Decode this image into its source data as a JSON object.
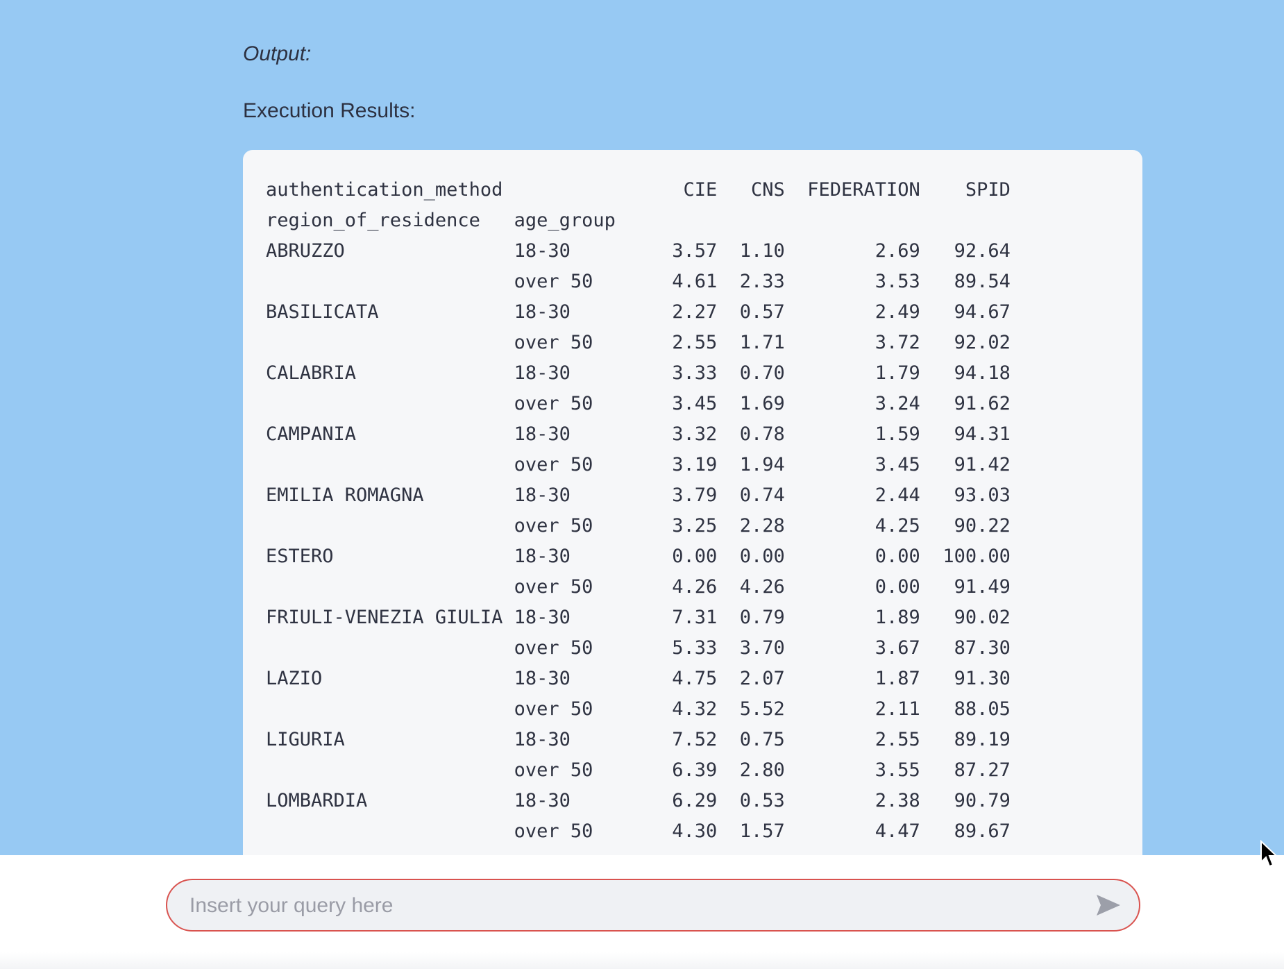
{
  "output_label": "Output:",
  "results_label": "Execution Results:",
  "table": {
    "header_lines": [
      "authentication_method                CIE   CNS  FEDERATION    SPID",
      "region_of_residence   age_group"
    ],
    "rows": [
      "ABRUZZO               18-30         3.57  1.10        2.69   92.64",
      "                      over 50       4.61  2.33        3.53   89.54",
      "BASILICATA            18-30         2.27  0.57        2.49   94.67",
      "                      over 50       2.55  1.71        3.72   92.02",
      "CALABRIA              18-30         3.33  0.70        1.79   94.18",
      "                      over 50       3.45  1.69        3.24   91.62",
      "CAMPANIA              18-30         3.32  0.78        1.59   94.31",
      "                      over 50       3.19  1.94        3.45   91.42",
      "EMILIA ROMAGNA        18-30         3.79  0.74        2.44   93.03",
      "                      over 50       3.25  2.28        4.25   90.22",
      "ESTERO                18-30         0.00  0.00        0.00  100.00",
      "                      over 50       4.26  4.26        0.00   91.49",
      "FRIULI-VENEZIA GIULIA 18-30         7.31  0.79        1.89   90.02",
      "                      over 50       5.33  3.70        3.67   87.30",
      "LAZIO                 18-30         4.75  2.07        1.87   91.30",
      "                      over 50       4.32  5.52        2.11   88.05",
      "LIGURIA               18-30         7.52  0.75        2.55   89.19",
      "                      over 50       6.39  2.80        3.55   87.27",
      "LOMBARDIA             18-30         6.29  0.53        2.38   90.79",
      "                      over 50       4.30  1.57        4.47   89.67"
    ]
  },
  "query": {
    "placeholder": "Insert your query here",
    "value": ""
  },
  "colors": {
    "background": "#97c9f3",
    "accent_border": "#d9534f"
  },
  "icons": {
    "send": "send-icon",
    "cursor": "mouse-pointer-icon"
  }
}
